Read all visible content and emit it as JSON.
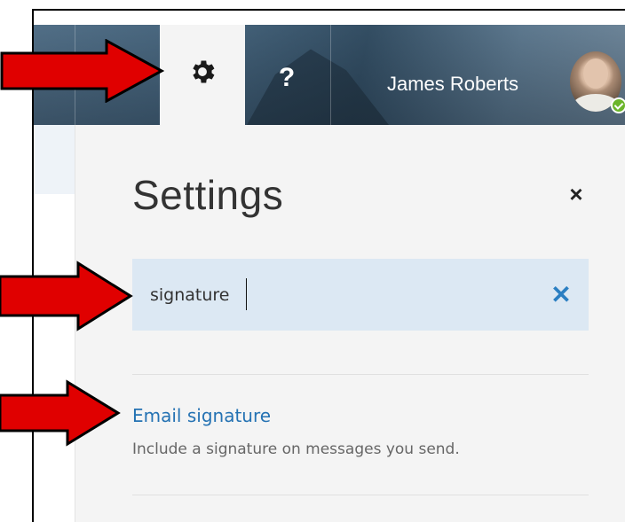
{
  "header": {
    "help_label": "?",
    "user_name": "James Roberts",
    "presence": "online"
  },
  "settings": {
    "title": "Settings",
    "close_label": "×",
    "search": {
      "value": "signature",
      "clear_label": "✕"
    },
    "results": [
      {
        "title": "Email signature",
        "description": "Include a signature on messages you send."
      }
    ]
  },
  "icons": {
    "settings": "gear-icon",
    "help": "question-mark-icon",
    "close": "close-icon",
    "clear": "close-icon",
    "annotation": "red-arrow-icon"
  },
  "colors": {
    "link": "#2472b3",
    "search_bg": "#dce8f3",
    "clear_icon": "#2b7fc2",
    "panel_bg": "#f4f4f4",
    "arrow_fill": "#e00000",
    "presence": "#6bb52a"
  }
}
